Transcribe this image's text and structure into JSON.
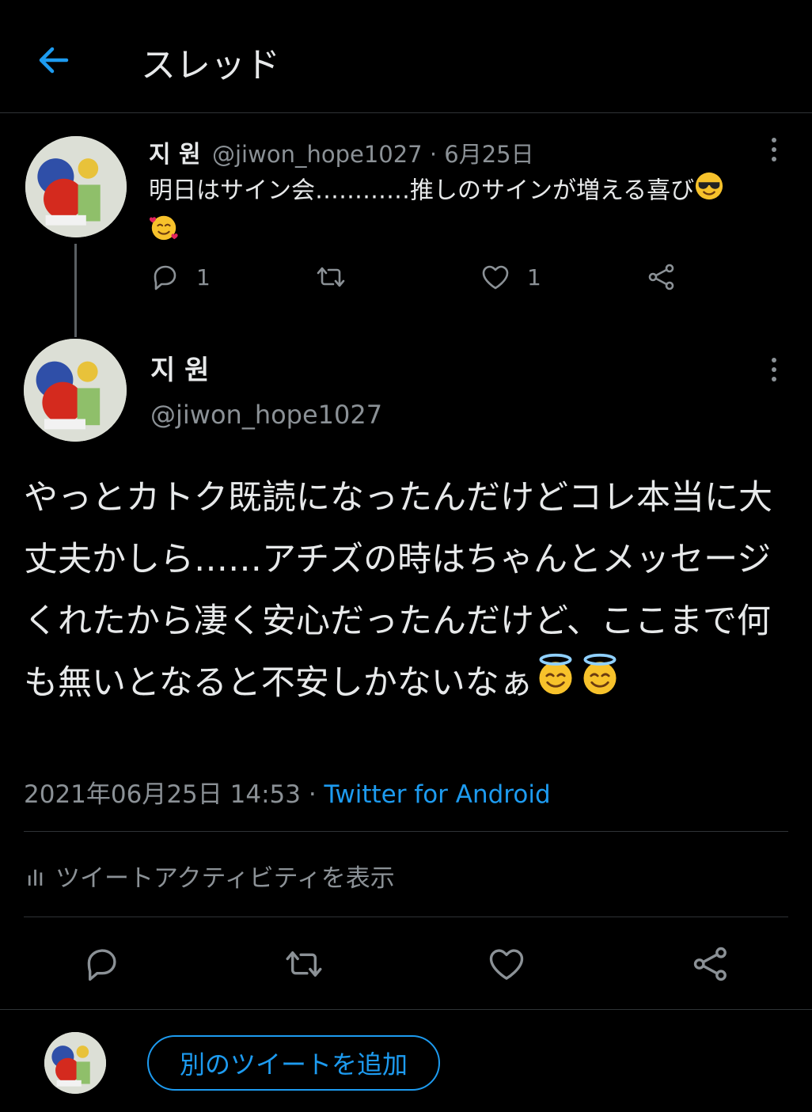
{
  "header": {
    "title": "スレッド"
  },
  "reply_tweet": {
    "name": "지 원",
    "handle_date": "@jiwon_hope1027 · 6月25日",
    "text": "明日はサイン会…………推しのサインが増える喜び",
    "reply_count": "1",
    "like_count": "1"
  },
  "main_tweet": {
    "name": "지 원",
    "handle": "@jiwon_hope1027",
    "text": "やっとカトク既読になったんだけどコレ本当に大丈夫かしら……アチズの時はちゃんとメッセージくれたから凄く安心だったんだけど、ここまで何も無いとなると不安しかないなぁ",
    "timestamp": "2021年06月25日 14:53 · ",
    "source": "Twitter for Android",
    "activity_label": "ツイートアクティビティを表示"
  },
  "composer": {
    "add_button": "別のツイートを追加"
  },
  "colors": {
    "accent": "#1d9bf0",
    "muted": "#8b9196",
    "background": "#000000"
  },
  "icons": [
    "back-arrow-icon",
    "more-icon",
    "reply-icon",
    "retweet-icon",
    "like-icon",
    "share-icon",
    "chart-icon",
    "sunglasses-emoji",
    "smiling-hearts-emoji",
    "halo-emoji"
  ]
}
